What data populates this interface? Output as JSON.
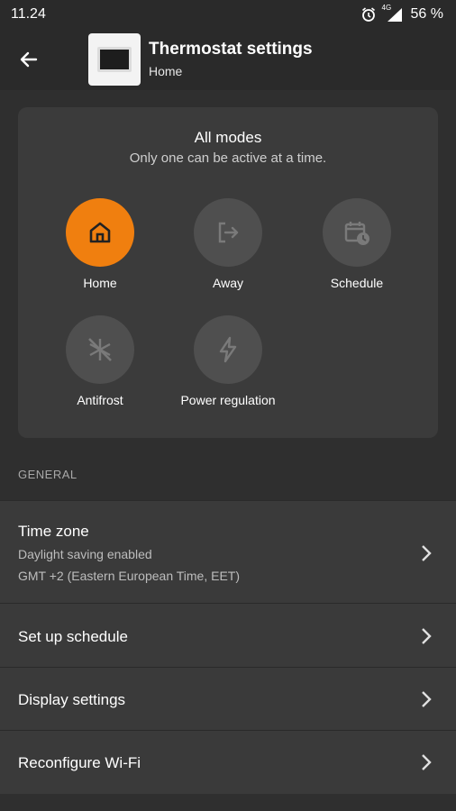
{
  "status_bar": {
    "time": "11.24",
    "network": "4G",
    "battery": "56 %"
  },
  "app_bar": {
    "title": "Thermostat settings",
    "subtitle": "Home"
  },
  "modes": {
    "title": "All modes",
    "subtitle": "Only one can be active at a time.",
    "items": [
      {
        "label": "Home",
        "icon": "home-icon",
        "active": true
      },
      {
        "label": "Away",
        "icon": "away-icon",
        "active": false
      },
      {
        "label": "Schedule",
        "icon": "schedule-icon",
        "active": false
      },
      {
        "label": "Antifrost",
        "icon": "antifrost-icon",
        "active": false
      },
      {
        "label": "Power regulation",
        "icon": "power-regulation-icon",
        "active": false
      }
    ],
    "accent_color": "#f07f0f"
  },
  "general": {
    "section_label": "GENERAL",
    "rows": [
      {
        "primary": "Time zone",
        "secondary": [
          "Daylight saving enabled",
          "GMT +2 (Eastern European Time, EET)"
        ]
      },
      {
        "primary": "Set up schedule"
      },
      {
        "primary": "Display settings"
      },
      {
        "primary": "Reconfigure Wi-Fi"
      }
    ]
  }
}
